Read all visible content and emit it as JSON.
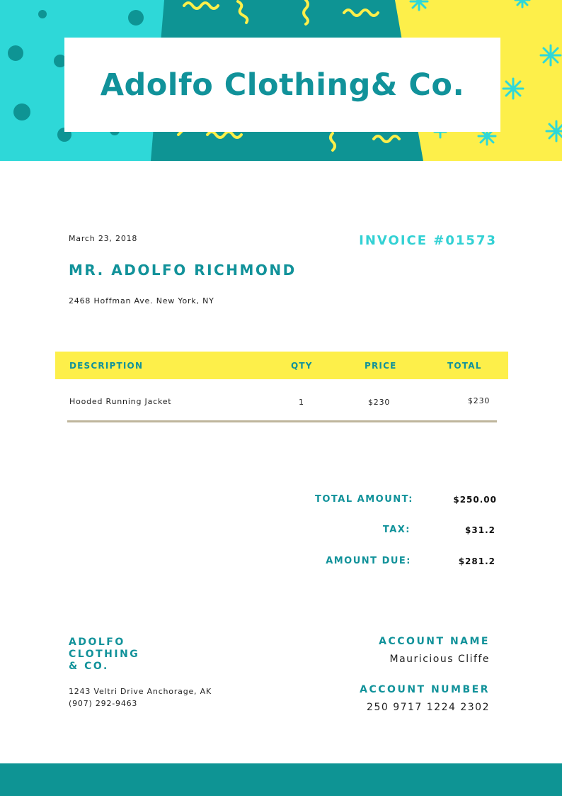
{
  "header": {
    "company_title": "Adolfo Clothing& Co.",
    "colors": {
      "cyan": "#2ed8d8",
      "teal": "#0e9494",
      "yellow": "#fdef4a"
    }
  },
  "invoice": {
    "date": "March 23, 2018",
    "number": "INVOICE #01573",
    "client_name": "MR. ADOLFO RICHMOND",
    "client_address": "2468 Hoffman Ave. New York, NY"
  },
  "table": {
    "headers": {
      "description": "DESCRIPTION",
      "qty": "QTY",
      "price": "PRICE",
      "total": "TOTAL"
    },
    "rows": [
      {
        "description": "Hooded Running Jacket",
        "qty": "1",
        "price": "$230",
        "total": "$230"
      }
    ]
  },
  "summary": {
    "total_amount_label": "TOTAL AMOUNT:",
    "total_amount": "$250.00",
    "tax_label": "TAX:",
    "tax": "$31.2",
    "amount_due_label": "AMOUNT DUE:",
    "amount_due": "$281.2"
  },
  "footer_info": {
    "company_line1": "ADOLFO",
    "company_line2": "CLOTHING",
    "company_line3": "& CO.",
    "address": "1243 Veltri Drive Anchorage, AK",
    "phone": "(907) 292-9463",
    "account_name_label": "ACCOUNT NAME",
    "account_name": "Mauricious Cliffe",
    "account_number_label": "ACCOUNT NUMBER",
    "account_number": "250 9717 1224 2302"
  }
}
